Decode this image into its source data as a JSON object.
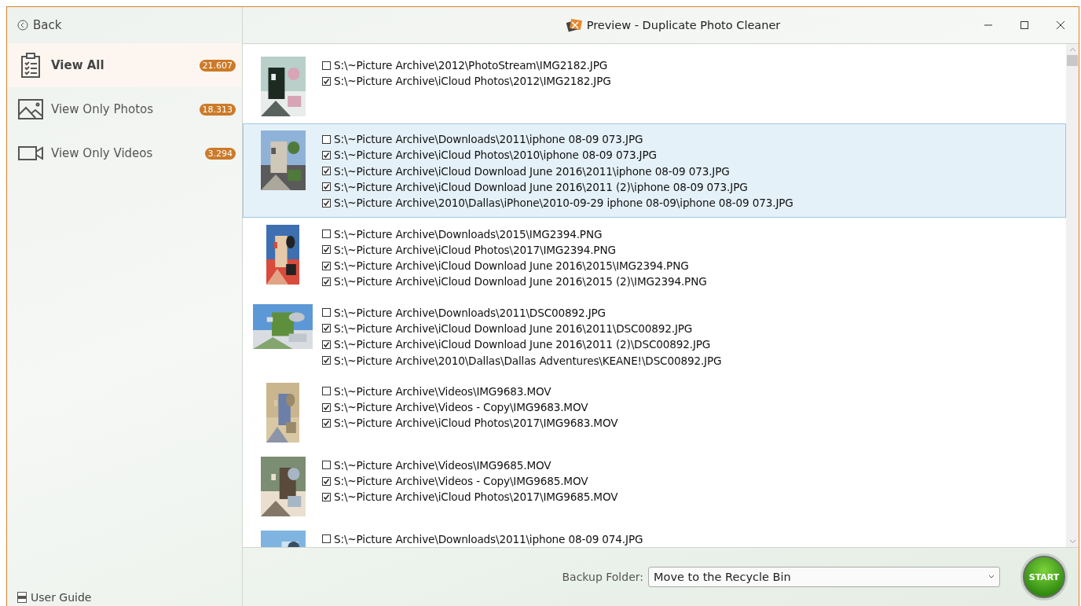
{
  "window": {
    "title": "Preview - Duplicate Photo Cleaner"
  },
  "sidebar": {
    "back": "Back",
    "items": [
      {
        "label": "View All",
        "count": "21.607",
        "selected": true,
        "kind": "all"
      },
      {
        "label": "View Only Photos",
        "count": "18.313",
        "selected": false,
        "kind": "photos"
      },
      {
        "label": "View Only Videos",
        "count": "3.294",
        "selected": false,
        "kind": "videos"
      }
    ],
    "user_guide": "User Guide"
  },
  "groups": [
    {
      "selected": false,
      "thumbnail": {
        "kind": "picture"
      },
      "files": [
        {
          "path": "S:\\~Picture Archive\\2012\\PhotoStream\\IMG2182.JPG",
          "checked": false
        },
        {
          "path": "S:\\~Picture Archive\\iCloud Photos\\2012\\IMG2182.JPG",
          "checked": true
        }
      ]
    },
    {
      "selected": true,
      "thumbnail": {
        "kind": "picture"
      },
      "files": [
        {
          "path": "S:\\~Picture Archive\\Downloads\\2011\\iphone 08-09 073.JPG",
          "checked": false
        },
        {
          "path": "S:\\~Picture Archive\\iCloud Photos\\2010\\iphone 08-09 073.JPG",
          "checked": true
        },
        {
          "path": "S:\\~Picture Archive\\iCloud Download June 2016\\2011\\iphone 08-09 073.JPG",
          "checked": true
        },
        {
          "path": "S:\\~Picture Archive\\iCloud Download June 2016\\2011 (2)\\iphone 08-09 073.JPG",
          "checked": true
        },
        {
          "path": "S:\\~Picture Archive\\2010\\Dallas\\iPhone\\2010-09-29 iphone 08-09\\iphone 08-09 073.JPG",
          "checked": true
        }
      ]
    },
    {
      "selected": false,
      "thumbnail": {
        "kind": "picture"
      },
      "files": [
        {
          "path": "S:\\~Picture Archive\\Downloads\\2015\\IMG2394.PNG",
          "checked": false
        },
        {
          "path": "S:\\~Picture Archive\\iCloud Photos\\2017\\IMG2394.PNG",
          "checked": true
        },
        {
          "path": "S:\\~Picture Archive\\iCloud Download June 2016\\2015\\IMG2394.PNG",
          "checked": true
        },
        {
          "path": "S:\\~Picture Archive\\iCloud Download June 2016\\2015 (2)\\IMG2394.PNG",
          "checked": true
        }
      ]
    },
    {
      "selected": false,
      "thumbnail": {
        "kind": "picture"
      },
      "files": [
        {
          "path": "S:\\~Picture Archive\\Downloads\\2011\\DSC00892.JPG",
          "checked": false
        },
        {
          "path": "S:\\~Picture Archive\\iCloud Download June 2016\\2011\\DSC00892.JPG",
          "checked": true
        },
        {
          "path": "S:\\~Picture Archive\\iCloud Download June 2016\\2011 (2)\\DSC00892.JPG",
          "checked": true
        },
        {
          "path": "S:\\~Picture Archive\\2010\\Dallas\\Dallas Adventures\\KEANE!\\DSC00892.JPG",
          "checked": true
        }
      ]
    },
    {
      "selected": false,
      "thumbnail": {
        "kind": "picture"
      },
      "files": [
        {
          "path": "S:\\~Picture Archive\\Videos\\IMG9683.MOV",
          "checked": false
        },
        {
          "path": "S:\\~Picture Archive\\Videos - Copy\\IMG9683.MOV",
          "checked": true
        },
        {
          "path": "S:\\~Picture Archive\\iCloud Photos\\2017\\IMG9683.MOV",
          "checked": true
        }
      ]
    },
    {
      "selected": false,
      "thumbnail": {
        "kind": "picture"
      },
      "files": [
        {
          "path": "S:\\~Picture Archive\\Videos\\IMG9685.MOV",
          "checked": false
        },
        {
          "path": "S:\\~Picture Archive\\Videos - Copy\\IMG9685.MOV",
          "checked": true
        },
        {
          "path": "S:\\~Picture Archive\\iCloud Photos\\2017\\IMG9685.MOV",
          "checked": true
        }
      ]
    },
    {
      "selected": false,
      "thumbnail": {
        "kind": "picture"
      },
      "files": [
        {
          "path": "S:\\~Picture Archive\\Downloads\\2011\\iphone 08-09 074.JPG",
          "checked": false
        }
      ]
    }
  ],
  "footer": {
    "backup_label": "Backup Folder:",
    "backup_value": "Move to the Recycle Bin",
    "start": "START"
  }
}
